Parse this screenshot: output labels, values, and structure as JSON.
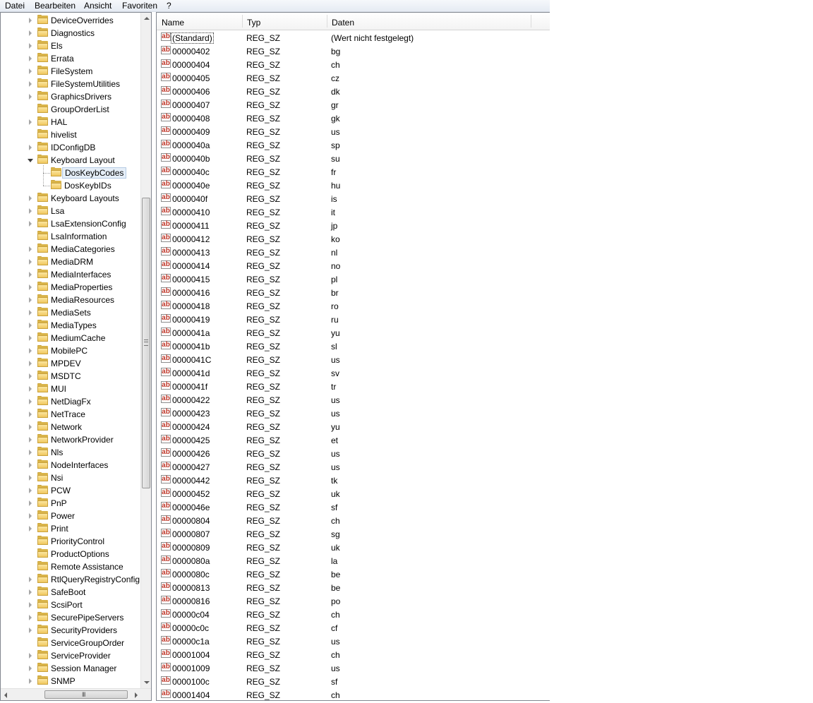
{
  "menu": [
    "Datei",
    "Bearbeiten",
    "Ansicht",
    "Favoriten",
    "?"
  ],
  "tree": {
    "items": [
      {
        "label": "DeviceOverrides",
        "level": 0,
        "expander": "collapsed"
      },
      {
        "label": "Diagnostics",
        "level": 0,
        "expander": "collapsed"
      },
      {
        "label": "Els",
        "level": 0,
        "expander": "collapsed"
      },
      {
        "label": "Errata",
        "level": 0,
        "expander": "collapsed"
      },
      {
        "label": "FileSystem",
        "level": 0,
        "expander": "collapsed"
      },
      {
        "label": "FileSystemUtilities",
        "level": 0,
        "expander": "collapsed"
      },
      {
        "label": "GraphicsDrivers",
        "level": 0,
        "expander": "collapsed"
      },
      {
        "label": "GroupOrderList",
        "level": 0,
        "expander": "none"
      },
      {
        "label": "HAL",
        "level": 0,
        "expander": "collapsed"
      },
      {
        "label": "hivelist",
        "level": 0,
        "expander": "none"
      },
      {
        "label": "IDConfigDB",
        "level": 0,
        "expander": "collapsed"
      },
      {
        "label": "Keyboard Layout",
        "level": 0,
        "expander": "expanded"
      },
      {
        "label": "DosKeybCodes",
        "level": 1,
        "expander": "none",
        "selected": true
      },
      {
        "label": "DosKeybIDs",
        "level": 1,
        "expander": "none"
      },
      {
        "label": "Keyboard Layouts",
        "level": 0,
        "expander": "collapsed"
      },
      {
        "label": "Lsa",
        "level": 0,
        "expander": "collapsed"
      },
      {
        "label": "LsaExtensionConfig",
        "level": 0,
        "expander": "collapsed"
      },
      {
        "label": "LsaInformation",
        "level": 0,
        "expander": "none"
      },
      {
        "label": "MediaCategories",
        "level": 0,
        "expander": "collapsed"
      },
      {
        "label": "MediaDRM",
        "level": 0,
        "expander": "collapsed"
      },
      {
        "label": "MediaInterfaces",
        "level": 0,
        "expander": "collapsed"
      },
      {
        "label": "MediaProperties",
        "level": 0,
        "expander": "collapsed"
      },
      {
        "label": "MediaResources",
        "level": 0,
        "expander": "collapsed"
      },
      {
        "label": "MediaSets",
        "level": 0,
        "expander": "collapsed"
      },
      {
        "label": "MediaTypes",
        "level": 0,
        "expander": "collapsed"
      },
      {
        "label": "MediumCache",
        "level": 0,
        "expander": "collapsed"
      },
      {
        "label": "MobilePC",
        "level": 0,
        "expander": "collapsed"
      },
      {
        "label": "MPDEV",
        "level": 0,
        "expander": "collapsed"
      },
      {
        "label": "MSDTC",
        "level": 0,
        "expander": "collapsed"
      },
      {
        "label": "MUI",
        "level": 0,
        "expander": "collapsed"
      },
      {
        "label": "NetDiagFx",
        "level": 0,
        "expander": "collapsed"
      },
      {
        "label": "NetTrace",
        "level": 0,
        "expander": "collapsed"
      },
      {
        "label": "Network",
        "level": 0,
        "expander": "collapsed"
      },
      {
        "label": "NetworkProvider",
        "level": 0,
        "expander": "collapsed"
      },
      {
        "label": "Nls",
        "level": 0,
        "expander": "collapsed"
      },
      {
        "label": "NodeInterfaces",
        "level": 0,
        "expander": "collapsed"
      },
      {
        "label": "Nsi",
        "level": 0,
        "expander": "collapsed"
      },
      {
        "label": "PCW",
        "level": 0,
        "expander": "collapsed"
      },
      {
        "label": "PnP",
        "level": 0,
        "expander": "collapsed"
      },
      {
        "label": "Power",
        "level": 0,
        "expander": "collapsed"
      },
      {
        "label": "Print",
        "level": 0,
        "expander": "collapsed"
      },
      {
        "label": "PriorityControl",
        "level": 0,
        "expander": "none"
      },
      {
        "label": "ProductOptions",
        "level": 0,
        "expander": "none"
      },
      {
        "label": "Remote Assistance",
        "level": 0,
        "expander": "none"
      },
      {
        "label": "RtlQueryRegistryConfig",
        "level": 0,
        "expander": "collapsed"
      },
      {
        "label": "SafeBoot",
        "level": 0,
        "expander": "collapsed"
      },
      {
        "label": "ScsiPort",
        "level": 0,
        "expander": "collapsed"
      },
      {
        "label": "SecurePipeServers",
        "level": 0,
        "expander": "collapsed"
      },
      {
        "label": "SecurityProviders",
        "level": 0,
        "expander": "collapsed"
      },
      {
        "label": "ServiceGroupOrder",
        "level": 0,
        "expander": "none"
      },
      {
        "label": "ServiceProvider",
        "level": 0,
        "expander": "collapsed"
      },
      {
        "label": "Session Manager",
        "level": 0,
        "expander": "collapsed"
      },
      {
        "label": "SNMP",
        "level": 0,
        "expander": "collapsed"
      }
    ]
  },
  "list": {
    "columns": [
      "Name",
      "Typ",
      "Daten"
    ],
    "rows": [
      [
        "(Standard)",
        "REG_SZ",
        "(Wert nicht festgelegt)"
      ],
      [
        "00000402",
        "REG_SZ",
        "bg"
      ],
      [
        "00000404",
        "REG_SZ",
        "ch"
      ],
      [
        "00000405",
        "REG_SZ",
        "cz"
      ],
      [
        "00000406",
        "REG_SZ",
        "dk"
      ],
      [
        "00000407",
        "REG_SZ",
        "gr"
      ],
      [
        "00000408",
        "REG_SZ",
        "gk"
      ],
      [
        "00000409",
        "REG_SZ",
        "us"
      ],
      [
        "0000040a",
        "REG_SZ",
        "sp"
      ],
      [
        "0000040b",
        "REG_SZ",
        "su"
      ],
      [
        "0000040c",
        "REG_SZ",
        "fr"
      ],
      [
        "0000040e",
        "REG_SZ",
        "hu"
      ],
      [
        "0000040f",
        "REG_SZ",
        "is"
      ],
      [
        "00000410",
        "REG_SZ",
        "it"
      ],
      [
        "00000411",
        "REG_SZ",
        "jp"
      ],
      [
        "00000412",
        "REG_SZ",
        "ko"
      ],
      [
        "00000413",
        "REG_SZ",
        "nl"
      ],
      [
        "00000414",
        "REG_SZ",
        "no"
      ],
      [
        "00000415",
        "REG_SZ",
        "pl"
      ],
      [
        "00000416",
        "REG_SZ",
        "br"
      ],
      [
        "00000418",
        "REG_SZ",
        "ro"
      ],
      [
        "00000419",
        "REG_SZ",
        "ru"
      ],
      [
        "0000041a",
        "REG_SZ",
        "yu"
      ],
      [
        "0000041b",
        "REG_SZ",
        "sl"
      ],
      [
        "0000041C",
        "REG_SZ",
        "us"
      ],
      [
        "0000041d",
        "REG_SZ",
        "sv"
      ],
      [
        "0000041f",
        "REG_SZ",
        "tr"
      ],
      [
        "00000422",
        "REG_SZ",
        "us"
      ],
      [
        "00000423",
        "REG_SZ",
        "us"
      ],
      [
        "00000424",
        "REG_SZ",
        "yu"
      ],
      [
        "00000425",
        "REG_SZ",
        "et"
      ],
      [
        "00000426",
        "REG_SZ",
        "us"
      ],
      [
        "00000427",
        "REG_SZ",
        "us"
      ],
      [
        "00000442",
        "REG_SZ",
        "tk"
      ],
      [
        "00000452",
        "REG_SZ",
        "uk"
      ],
      [
        "0000046e",
        "REG_SZ",
        "sf"
      ],
      [
        "00000804",
        "REG_SZ",
        "ch"
      ],
      [
        "00000807",
        "REG_SZ",
        "sg"
      ],
      [
        "00000809",
        "REG_SZ",
        "uk"
      ],
      [
        "0000080a",
        "REG_SZ",
        "la"
      ],
      [
        "0000080c",
        "REG_SZ",
        "be"
      ],
      [
        "00000813",
        "REG_SZ",
        "be"
      ],
      [
        "00000816",
        "REG_SZ",
        "po"
      ],
      [
        "00000c04",
        "REG_SZ",
        "ch"
      ],
      [
        "00000c0c",
        "REG_SZ",
        "cf"
      ],
      [
        "00000c1a",
        "REG_SZ",
        "us"
      ],
      [
        "00001004",
        "REG_SZ",
        "ch"
      ],
      [
        "00001009",
        "REG_SZ",
        "us"
      ],
      [
        "0000100c",
        "REG_SZ",
        "sf"
      ],
      [
        "00001404",
        "REG_SZ",
        "ch"
      ]
    ],
    "value_icon_text": "ab"
  },
  "scrollbars": {
    "tree_horizontal_grip": "III",
    "tree_vertical_position": 0.42
  },
  "colors": {
    "selection_bg": "#e5eef8",
    "selection_border": "#b5cbe3",
    "folder": "#f0c75e",
    "value_icon_text": "#c0392b"
  }
}
